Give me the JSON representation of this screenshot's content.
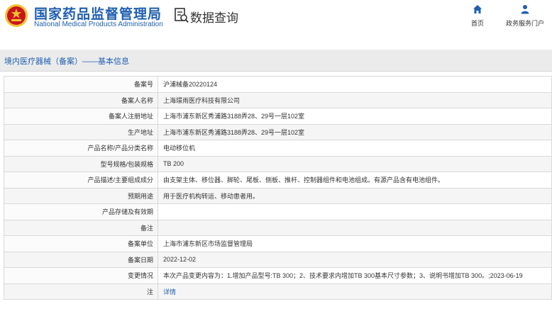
{
  "header": {
    "brand_cn": "国家药品监督管理局",
    "brand_en": "National Medical Products Administration",
    "query_title": "数据查询",
    "nav": [
      {
        "label": "首页",
        "icon": "home-icon"
      },
      {
        "label": "政务服务门户",
        "icon": "user-icon"
      }
    ]
  },
  "breadcrumb": "境内医疗器械（备案）——基本信息",
  "rows": [
    {
      "label": "备案号",
      "value": "沪浦械备20220124"
    },
    {
      "label": "备案人名称",
      "value": "上海璟雨医疗科技有限公司"
    },
    {
      "label": "备案人注册地址",
      "value": "上海市浦东新区秀浦路3188弄28、29号一层102室"
    },
    {
      "label": "生产地址",
      "value": "上海市浦东新区秀浦路3188弄28、29号一层102室"
    },
    {
      "label": "产品名称/产品分类名称",
      "value": "电动移位机"
    },
    {
      "label": "型号规格/包装规格",
      "value": "TB 200"
    },
    {
      "label": "产品描述/主要组成成分",
      "value": "由支架主体、移位器、脚轮、尾板、侧板、推杆、控制器组件和电池组成。有源产品含有电池组件。"
    },
    {
      "label": "预期用途",
      "value": "用于医疗机构转运、移动患者用。"
    },
    {
      "label": "产品存储及有效期",
      "value": ""
    },
    {
      "label": "备注",
      "value": ""
    },
    {
      "label": "备案单位",
      "value": "上海市浦东新区市场监督管理局"
    },
    {
      "label": "备案日期",
      "value": "2022-12-02"
    },
    {
      "label": "变更情况",
      "value": "本次产品变更内容为：1.增加产品型号:TB 300；2、技术要求内增加TB 300基本尺寸参数；3、说明书增加TB 300。;2023-06-19"
    },
    {
      "label": "注",
      "value": "详情",
      "link": true
    }
  ],
  "colors": {
    "brand": "#1f5fb0",
    "emblem_red": "#c8161d",
    "emblem_gold": "#f2c230"
  }
}
